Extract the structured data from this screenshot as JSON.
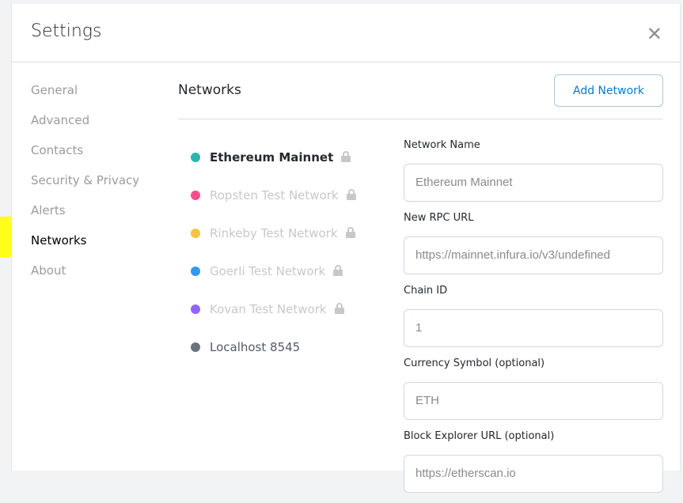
{
  "header": {
    "title": "Settings",
    "close_icon": "close-icon"
  },
  "sidebar": {
    "items": [
      "General",
      "Advanced",
      "Contacts",
      "Security & Privacy",
      "Alerts",
      "Networks",
      "About"
    ],
    "active": "Networks",
    "highlight_color": "#ffff1a"
  },
  "main": {
    "title": "Networks",
    "add_button": "Add Network",
    "networks": [
      {
        "name": "Ethereum Mainnet",
        "color": "#29b6af",
        "locked": true,
        "selected": true
      },
      {
        "name": "Ropsten Test Network",
        "color": "#ff4a8d",
        "locked": true
      },
      {
        "name": "Rinkeby Test Network",
        "color": "#f6c343",
        "locked": true
      },
      {
        "name": "Goerli Test Network",
        "color": "#3099f2",
        "locked": true
      },
      {
        "name": "Kovan Test Network",
        "color": "#9064ff",
        "locked": true
      },
      {
        "name": "Localhost 8545",
        "color": "#6a737d",
        "locked": false
      }
    ],
    "form": [
      {
        "label": "Network Name",
        "value": "Ethereum Mainnet"
      },
      {
        "label": "New RPC URL",
        "value": "https://mainnet.infura.io/v3/undefined"
      },
      {
        "label": "Chain ID",
        "value": "1"
      },
      {
        "label": "Currency Symbol (optional)",
        "value": "ETH"
      },
      {
        "label": "Block Explorer URL (optional)",
        "value": "https://etherscan.io"
      }
    ]
  }
}
